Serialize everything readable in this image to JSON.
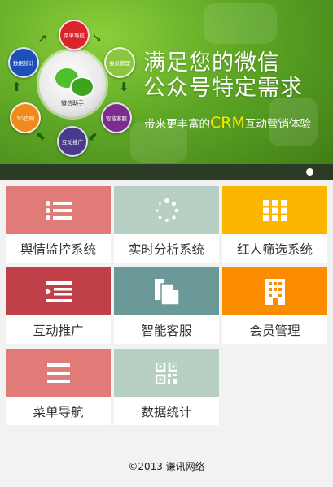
{
  "banner": {
    "headline_line1": "满足您的微信",
    "headline_line2": "公众号特定需求",
    "sub_prefix": "带来更丰富的",
    "sub_crm": "CRM",
    "sub_suffix": "互动营销体验",
    "hub_label": "微信助手",
    "nodes": [
      {
        "label": "菜单导航",
        "color": "#d9252a"
      },
      {
        "label": "会员管理",
        "color": "#8cc63f"
      },
      {
        "label": "智能客服",
        "color": "#7b2d8e"
      },
      {
        "label": "互动推广",
        "color": "#4a3a8c"
      },
      {
        "label": "3G官网",
        "color": "#f08a1c"
      },
      {
        "label": "数据统计",
        "color": "#1c4fb8"
      }
    ],
    "slide_count": 1,
    "active_slide": 1
  },
  "tiles": [
    {
      "label": "舆情监控系统",
      "color": "#e07b78",
      "icon": "list-icon"
    },
    {
      "label": "实时分析系统",
      "color": "#b8d0c4",
      "icon": "loading-spinner-icon"
    },
    {
      "label": "红人筛选系统",
      "color": "#fbb600",
      "icon": "grid-icon"
    },
    {
      "label": "互动推广",
      "color": "#c0404a",
      "icon": "indent-list-icon"
    },
    {
      "label": "智能客服",
      "color": "#6a9998",
      "icon": "documents-icon"
    },
    {
      "label": "会员管理",
      "color": "#fb8c00",
      "icon": "building-icon"
    },
    {
      "label": "菜单导航",
      "color": "#e07b78",
      "icon": "menu-icon"
    },
    {
      "label": "数据统计",
      "color": "#b8d0c4",
      "icon": "qr-code-icon"
    }
  ],
  "footer": {
    "copyright": "©2013 谦讯网络"
  }
}
